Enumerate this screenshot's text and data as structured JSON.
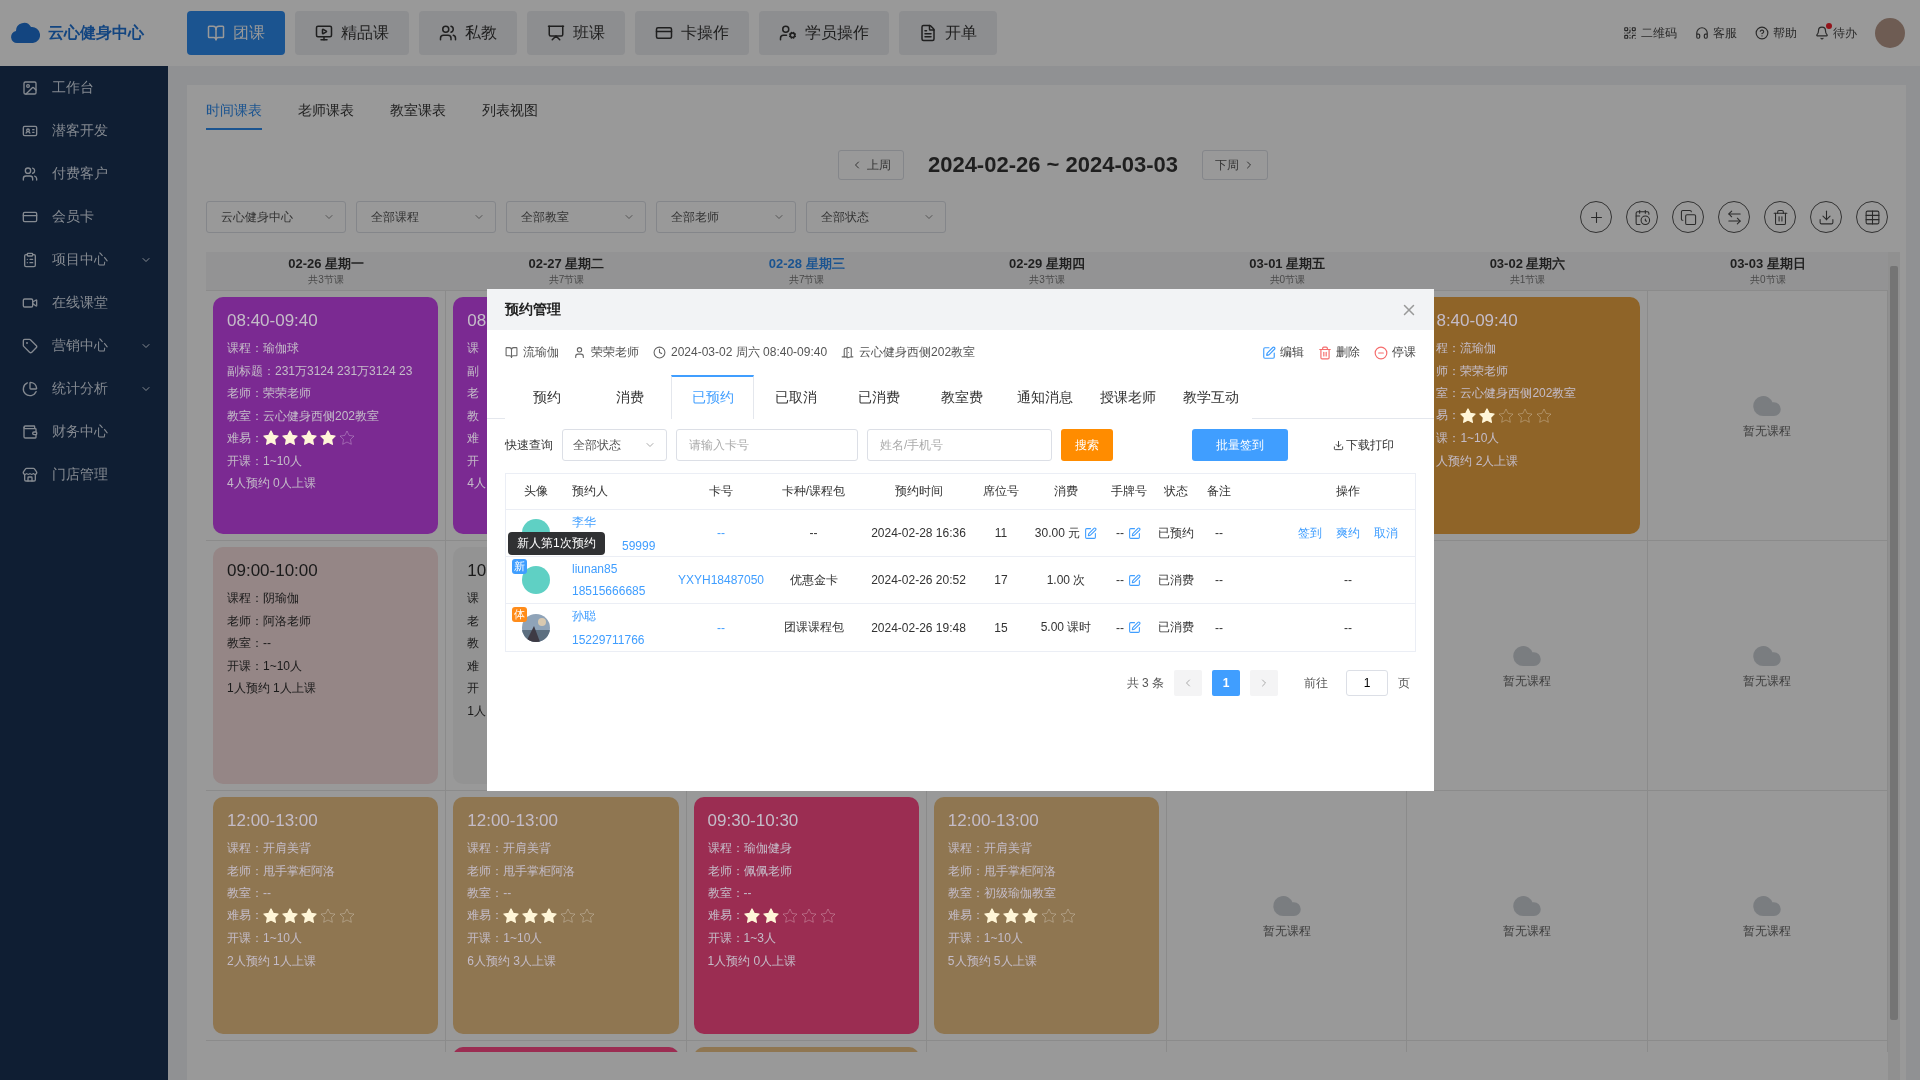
{
  "app": {
    "name": "云心健身中心"
  },
  "top_nav": [
    {
      "label": "团课",
      "selected": true
    },
    {
      "label": "精品课",
      "selected": false
    },
    {
      "label": "私教",
      "selected": false
    },
    {
      "label": "班课",
      "selected": false
    },
    {
      "label": "卡操作",
      "selected": false
    },
    {
      "label": "学员操作",
      "selected": false
    },
    {
      "label": "开单",
      "selected": false
    }
  ],
  "header_tools": [
    {
      "label": "二维码",
      "dot": false
    },
    {
      "label": "客服",
      "dot": false
    },
    {
      "label": "帮助",
      "dot": false
    },
    {
      "label": "待办",
      "dot": true
    }
  ],
  "sidebar": {
    "items": [
      {
        "label": "工作台",
        "kind": "link"
      },
      {
        "label": "潜客开发",
        "kind": "link"
      },
      {
        "label": "付费客户",
        "kind": "link"
      },
      {
        "label": "会员卡",
        "kind": "link"
      },
      {
        "label": "项目中心",
        "kind": "menu"
      },
      {
        "label": "在线课堂",
        "kind": "link"
      },
      {
        "label": "营销中心",
        "kind": "menu"
      },
      {
        "label": "统计分析",
        "kind": "menu"
      },
      {
        "label": "财务中心",
        "kind": "link"
      },
      {
        "label": "门店管理",
        "kind": "link"
      }
    ]
  },
  "view_tabs": [
    {
      "label": "时间课表",
      "selected": true
    },
    {
      "label": "老师课表",
      "selected": false
    },
    {
      "label": "教室课表",
      "selected": false
    },
    {
      "label": "列表视图",
      "selected": false
    }
  ],
  "week": {
    "prev": "上周",
    "range": "2024-02-26 ~ 2024-03-03",
    "next": "下周"
  },
  "filters": [
    "云心健身中心",
    "全部课程",
    "全部教室",
    "全部老师",
    "全部状态"
  ],
  "days": [
    {
      "date": "02-26 星期一",
      "count": "共3节课",
      "selected": false
    },
    {
      "date": "02-27 星期二",
      "count": "共7节课",
      "selected": false
    },
    {
      "date": "02-28 星期三",
      "count": "共7节课",
      "selected": true
    },
    {
      "date": "02-29 星期四",
      "count": "共3节课",
      "selected": false
    },
    {
      "date": "03-01 星期五",
      "count": "共0节课",
      "selected": false
    },
    {
      "date": "03-02 星期六",
      "count": "共1节课",
      "selected": false
    },
    {
      "date": "03-03 星期日",
      "count": "共0节课",
      "selected": false
    }
  ],
  "schedule": [
    {
      "cells": [
        {
          "kind": "course",
          "color": "#7b2a92",
          "time": "08:40-09:40",
          "lines": [
            {
              "text": "课程：瑜伽球"
            },
            {
              "text": "副标题：231万3124 231万3124 23"
            },
            {
              "text": "老师：荣荣老师"
            },
            {
              "text": "教室：云心健身西侧202教室"
            },
            {
              "label": "难易：",
              "stars": 4
            },
            {
              "text": "开课：1~10人"
            },
            {
              "text": "4人预约 0人上课"
            }
          ]
        },
        {
          "kind": "course",
          "color": "#7b2a92",
          "time": "08",
          "lines": [
            {
              "text": "课"
            },
            {
              "text": "副"
            },
            {
              "text": "老"
            },
            {
              "text": "教"
            },
            {
              "text": "难"
            },
            {
              "text": "开"
            },
            {
              "text": "4人"
            }
          ]
        },
        {
          "kind": "blank"
        },
        {
          "kind": "blank"
        },
        {
          "kind": "blank"
        },
        {
          "kind": "course_cut",
          "color": "#8f6428",
          "time": "8:40-09:40",
          "lines": [
            {
              "text": "程：流瑜伽"
            },
            {
              "text": "师：荣荣老师"
            },
            {
              "text": "室：云心健身西侧202教室"
            },
            {
              "label": "易：",
              "stars": 2
            },
            {
              "text": "课：1~10人"
            },
            {
              "text": "人预约 2人上课"
            }
          ]
        },
        {
          "kind": "empty",
          "text": "暂无课程"
        }
      ]
    },
    {
      "cells": [
        {
          "kind": "course",
          "color": "#958686",
          "time": "09:00-10:00",
          "lines": [
            {
              "text": "课程：阴瑜伽"
            },
            {
              "text": "老师：阿洛老师"
            },
            {
              "text": "教室：--"
            },
            {
              "text": "开课：1~10人"
            },
            {
              "text": "1人预约 1人上课"
            }
          ]
        },
        {
          "kind": "course",
          "color": "#939393",
          "time": "10",
          "lines": [
            {
              "text": "课"
            },
            {
              "text": "老"
            },
            {
              "text": "教"
            },
            {
              "text": "难"
            },
            {
              "text": "开"
            },
            {
              "text": "1人"
            }
          ]
        },
        {
          "kind": "blank"
        },
        {
          "kind": "blank"
        },
        {
          "kind": "blank"
        },
        {
          "kind": "empty",
          "text": "暂无课程"
        },
        {
          "kind": "empty",
          "text": "暂无课程"
        }
      ]
    },
    {
      "cells": [
        {
          "kind": "course",
          "color": "#8f7651",
          "time": "12:00-13:00",
          "lines": [
            {
              "text": "课程：开肩美背"
            },
            {
              "text": "老师：甩手掌柜阿洛"
            },
            {
              "text": "教室：--"
            },
            {
              "label": "难易：",
              "stars": 3
            },
            {
              "text": "开课：1~10人"
            },
            {
              "text": "2人预约 1人上课"
            }
          ]
        },
        {
          "kind": "course",
          "color": "#8f7651",
          "time": "12:00-13:00",
          "lines": [
            {
              "text": "课程：开肩美背"
            },
            {
              "text": "老师：甩手掌柜阿洛"
            },
            {
              "text": "教室：--"
            },
            {
              "label": "难易：",
              "stars": 3
            },
            {
              "text": "开课：1~10人"
            },
            {
              "text": "6人预约 3人上课"
            }
          ]
        },
        {
          "kind": "course",
          "color": "#9b2d52",
          "time": "09:30-10:30",
          "lines": [
            {
              "text": "课程：瑜伽健身"
            },
            {
              "text": "老师：佩佩老师"
            },
            {
              "text": "教室：--"
            },
            {
              "label": "难易：",
              "stars": 2
            },
            {
              "text": "开课：1~3人"
            },
            {
              "text": "1人预约 0人上课"
            }
          ]
        },
        {
          "kind": "course",
          "color": "#8f7651",
          "time": "12:00-13:00",
          "lines": [
            {
              "text": "课程：开肩美背"
            },
            {
              "text": "老师：甩手掌柜阿洛"
            },
            {
              "text": "教室：初级瑜伽教室"
            },
            {
              "label": "难易：",
              "stars": 3
            },
            {
              "text": "开课：1~10人"
            },
            {
              "text": "5人预约 5人上课"
            }
          ]
        },
        {
          "kind": "empty",
          "text": "暂无课程"
        },
        {
          "kind": "empty",
          "text": "暂无课程"
        },
        {
          "kind": "empty",
          "text": "暂无课程"
        }
      ]
    },
    {
      "cells": [
        {
          "kind": "blank"
        },
        {
          "kind": "stub",
          "color": "#9b2d52"
        },
        {
          "kind": "stub",
          "color": "#8f7651"
        },
        {
          "kind": "blank"
        },
        {
          "kind": "blank"
        },
        {
          "kind": "blank"
        },
        {
          "kind": "blank"
        }
      ]
    }
  ],
  "booking_dialog": {
    "title": "预约管理",
    "info": [
      {
        "kind": "course",
        "text": "流瑜伽"
      },
      {
        "kind": "teacher",
        "text": "荣荣老师"
      },
      {
        "kind": "time",
        "text": "2024-03-02 周六 08:40-09:40"
      },
      {
        "kind": "room",
        "text": "云心健身西侧202教室"
      }
    ],
    "actions": [
      {
        "kind": "edit",
        "label": "编辑"
      },
      {
        "kind": "delete",
        "label": "删除"
      },
      {
        "kind": "suspend",
        "label": "停课"
      }
    ],
    "tabs": [
      {
        "label": "预约",
        "selected": false
      },
      {
        "label": "消费",
        "selected": false
      },
      {
        "label": "已预约",
        "selected": true
      },
      {
        "label": "已取消",
        "selected": false
      },
      {
        "label": "已消费",
        "selected": false
      },
      {
        "label": "教室费",
        "selected": false
      },
      {
        "label": "通知消息",
        "selected": false
      },
      {
        "label": "授课老师",
        "selected": false
      },
      {
        "label": "教学互动",
        "selected": false
      }
    ],
    "query": {
      "label": "快速查询",
      "status": "全部状态",
      "card_placeholder": "请输入卡号",
      "name_placeholder": "姓名/手机号",
      "search": "搜索",
      "batch": "批量签到",
      "download": "下载打印"
    },
    "table": {
      "columns": [
        "头像",
        "预约人",
        "卡号",
        "卡种/课程包",
        "预约时间",
        "席位号",
        "消费",
        "手牌号",
        "状态",
        "备注",
        "操作"
      ],
      "rows": [
        {
          "avatar": {
            "kind": "cartoon"
          },
          "name": "李华",
          "phone": "59999",
          "card": "--",
          "card_type": "--",
          "time": "2024-02-28 16:36",
          "seat": "11",
          "consume": "30.00 元",
          "consume_editable": true,
          "hand": "--",
          "status": "已预约",
          "note": "--",
          "actions": [
            "签到",
            "爽约",
            "取消"
          ]
        },
        {
          "avatar": {
            "kind": "cartoon"
          },
          "badge": {
            "kind": "new",
            "text": "新",
            "tooltip": "新人第1次预约"
          },
          "name": "liunan85",
          "phone": "18515666685",
          "card": "YXYH18487050",
          "card_type": "优惠金卡",
          "time": "2024-02-26 20:52",
          "seat": "17",
          "consume": "1.00 次",
          "consume_editable": false,
          "hand": "--",
          "status": "已消费",
          "note": "--",
          "actions_text": "--"
        },
        {
          "badge": {
            "kind": "trial",
            "text": "体"
          },
          "name": "孙聪",
          "phone": "15229711766",
          "card": "--",
          "card_type": "团课课程包",
          "time": "2024-02-26 19:48",
          "seat": "15",
          "consume": "5.00 课时",
          "consume_editable": false,
          "hand": "--",
          "status": "已消费",
          "note": "--",
          "actions_text": "--"
        }
      ]
    },
    "pagination": {
      "total": "共 3 条",
      "pages": [
        {
          "label": "1",
          "selected": true
        }
      ],
      "goto": "前往",
      "page_input": "1",
      "unit": "页"
    }
  }
}
